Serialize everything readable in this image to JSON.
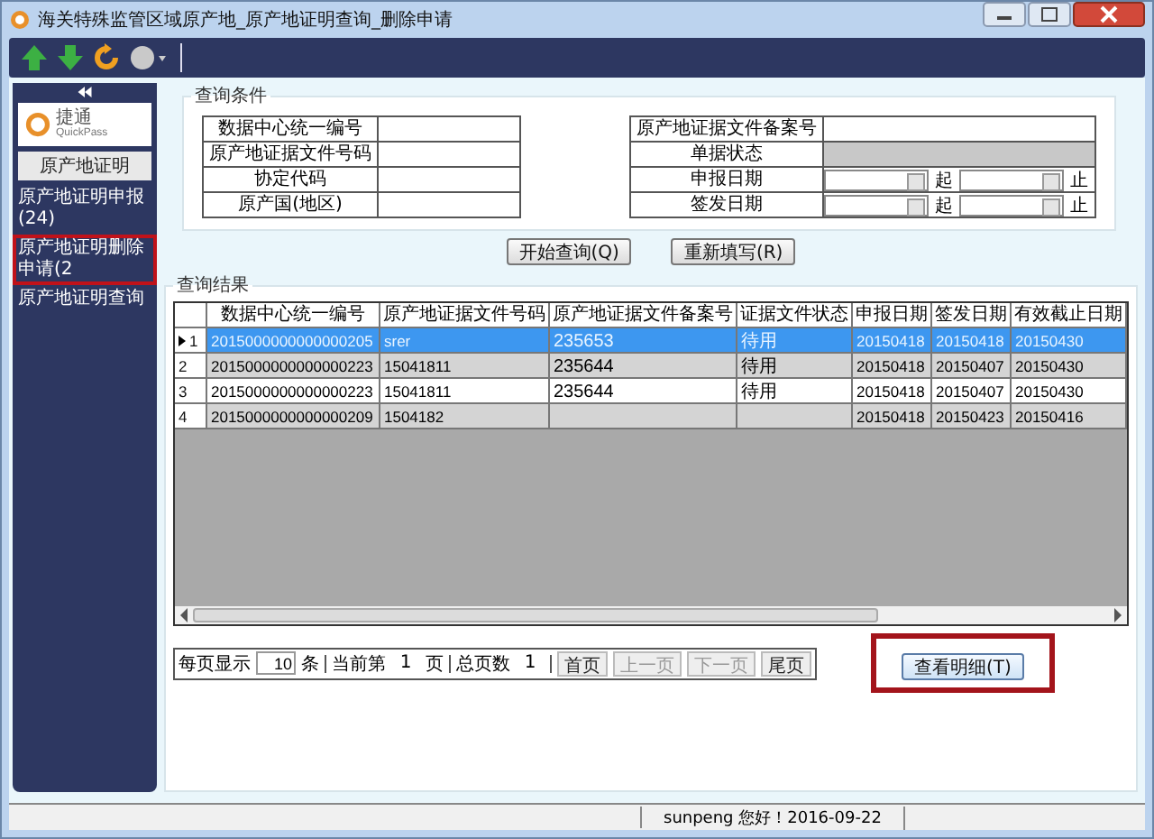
{
  "window": {
    "title": "海关特殊监管区域原产地_原产地证明查询_删除申请"
  },
  "sidebar": {
    "logo": {
      "name": "捷通",
      "subtitle": "QuickPass"
    },
    "section": "原产地证明",
    "items": [
      {
        "label": "原产地证明申报(24)",
        "selected": false
      },
      {
        "label": "原产地证明删除申请(2",
        "selected": true
      },
      {
        "label": "原产地证明查询",
        "selected": false
      }
    ]
  },
  "query": {
    "title": "查询条件",
    "left_fields": [
      {
        "label": "数据中心统一编号"
      },
      {
        "label": "原产地证据文件号码"
      },
      {
        "label": "协定代码"
      },
      {
        "label": "原产国(地区)"
      }
    ],
    "right_fields": [
      {
        "label": "原产地证据文件备案号",
        "kind": "text"
      },
      {
        "label": "单据状态",
        "kind": "readonly"
      },
      {
        "label": "申报日期",
        "kind": "range",
        "from": "起",
        "to": "止"
      },
      {
        "label": "签发日期",
        "kind": "range",
        "from": "起",
        "to": "止"
      }
    ],
    "buttons": [
      "开始查询(Q)",
      "重新填写(R)"
    ]
  },
  "results": {
    "title": "查询结果",
    "columns": [
      "数据中心统一编号",
      "原产地证据文件号码",
      "原产地证据文件备案号",
      "证据文件状态",
      "申报日期",
      "签发日期",
      "有效截止日期"
    ],
    "rows": [
      {
        "index": "1",
        "selected": true,
        "cells": [
          "2015000000000000205",
          "srer",
          "235653",
          "待用",
          "20150418",
          "20150418",
          "20150430"
        ]
      },
      {
        "index": "2",
        "selected": false,
        "cells": [
          "2015000000000000223",
          "15041811",
          "235644",
          "待用",
          "20150418",
          "20150407",
          "20150430"
        ]
      },
      {
        "index": "3",
        "selected": false,
        "cells": [
          "2015000000000000223",
          "15041811",
          "235644",
          "待用",
          "20150418",
          "20150407",
          "20150430"
        ]
      },
      {
        "index": "4",
        "selected": false,
        "cells": [
          "2015000000000000209",
          "1504182",
          null,
          null,
          "20150418",
          "20150423",
          "20150416"
        ]
      }
    ],
    "pager": {
      "per_page_label": "每页显示",
      "per_page": "10",
      "unit": "条",
      "current_label": "当前第",
      "current": "1",
      "page_label": "页",
      "total_label": "总页数",
      "total": "1",
      "buttons": [
        {
          "label": "首页",
          "disabled": false
        },
        {
          "label": "上一页",
          "disabled": true
        },
        {
          "label": "下一页",
          "disabled": true
        },
        {
          "label": "尾页",
          "disabled": false
        }
      ]
    },
    "detail_button": "查看明细(T)"
  },
  "status_bar": {
    "user_text": "sunpeng  您好！2016-09-22"
  }
}
